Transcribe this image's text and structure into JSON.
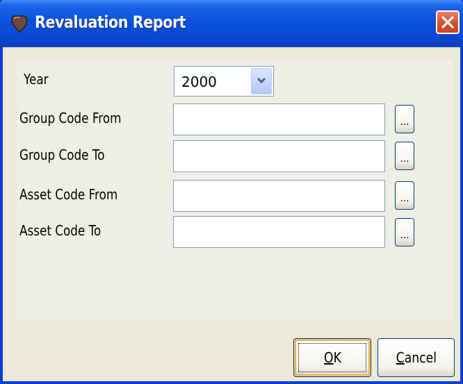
{
  "window": {
    "title": "Revaluation Report",
    "icon": "diamond-app-icon",
    "close_icon": "close-icon"
  },
  "form": {
    "year": {
      "label": "Year",
      "value": "2000"
    },
    "fields": [
      {
        "label": "Group Code From",
        "value": ""
      },
      {
        "label": "Group Code To",
        "value": ""
      },
      {
        "label": "Asset Code From",
        "value": ""
      },
      {
        "label": "Asset Code To",
        "value": ""
      }
    ],
    "browse_label": "..."
  },
  "buttons": {
    "ok": {
      "mnemonic": "O",
      "rest": "K"
    },
    "cancel": {
      "mnemonic": "C",
      "rest": "ancel"
    }
  },
  "colors": {
    "titlebar": "#0a50dc",
    "close": "#d9542e",
    "window_bg": "#ece9d8"
  }
}
